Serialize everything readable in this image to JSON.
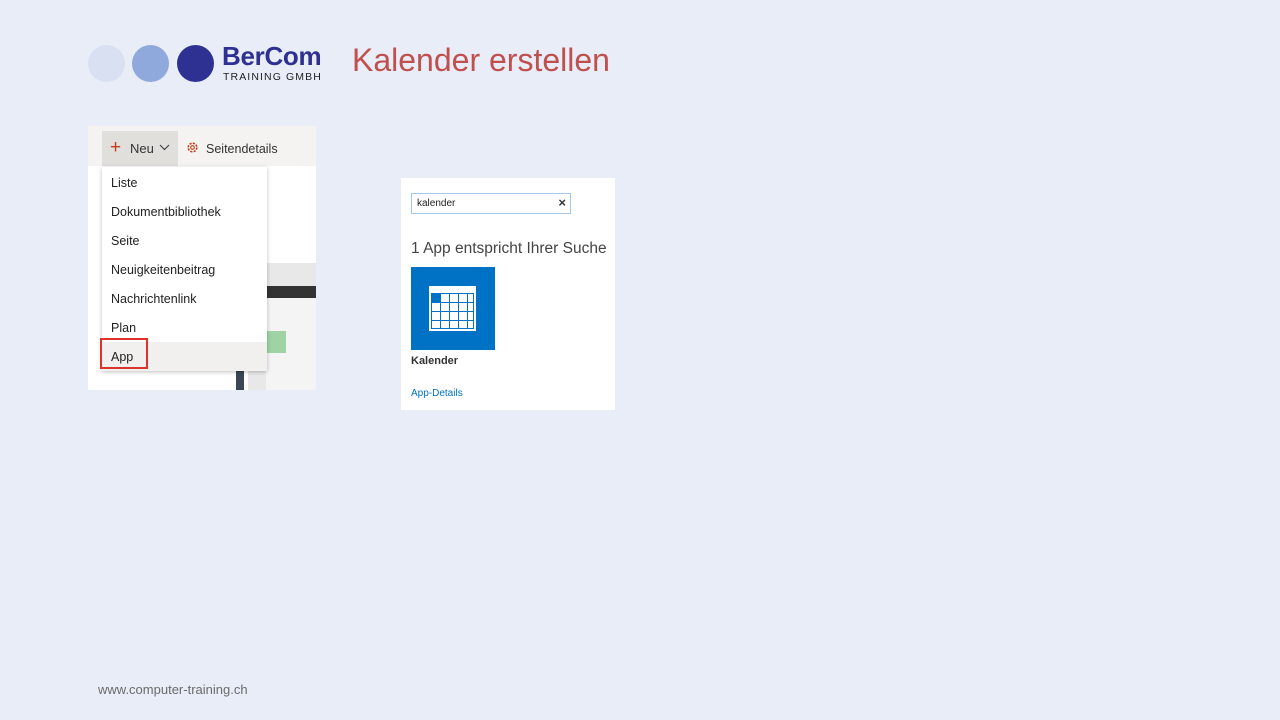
{
  "logo": {
    "brand": "BerCom",
    "sub": "TRAINING GMBH"
  },
  "title": "Kalender erstellen",
  "footer": "www.computer-training.ch",
  "shot1": {
    "new_label": "Neu",
    "details_label": "Seitendetails",
    "menu": [
      {
        "label": "Liste"
      },
      {
        "label": "Dokumentbibliothek"
      },
      {
        "label": "Seite"
      },
      {
        "label": "Neuigkeitenbeitrag"
      },
      {
        "label": "Nachrichtenlink"
      },
      {
        "label": "Plan"
      },
      {
        "label": "App"
      }
    ],
    "highlight_color": "#e0322d"
  },
  "shot2": {
    "search_value": "kalender",
    "clear": "×",
    "result": "1 App entspricht Ihrer Suche",
    "app_name": "Kalender",
    "app_details": "App-Details",
    "tile_color": "#0072c6"
  },
  "colors": {
    "title": "#c0504d",
    "brand": "#2e3192",
    "background": "#e9edf8"
  }
}
